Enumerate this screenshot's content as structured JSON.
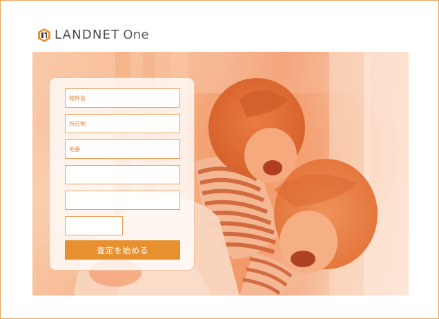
{
  "brand": {
    "name": "LANDNET",
    "suffix": "One",
    "accent_color": "#e7902f",
    "text_color": "#4b4b4b"
  },
  "form": {
    "fields": [
      {
        "placeholder": "物件名",
        "value": ""
      },
      {
        "placeholder": "所在地",
        "value": ""
      },
      {
        "placeholder": "地番",
        "value": ""
      },
      {
        "placeholder": "",
        "value": ""
      },
      {
        "placeholder": "",
        "value": ""
      },
      {
        "placeholder": "",
        "value": ""
      }
    ],
    "submit_label": "査定を始める"
  },
  "hero": {
    "icon": "photo-illustration"
  }
}
